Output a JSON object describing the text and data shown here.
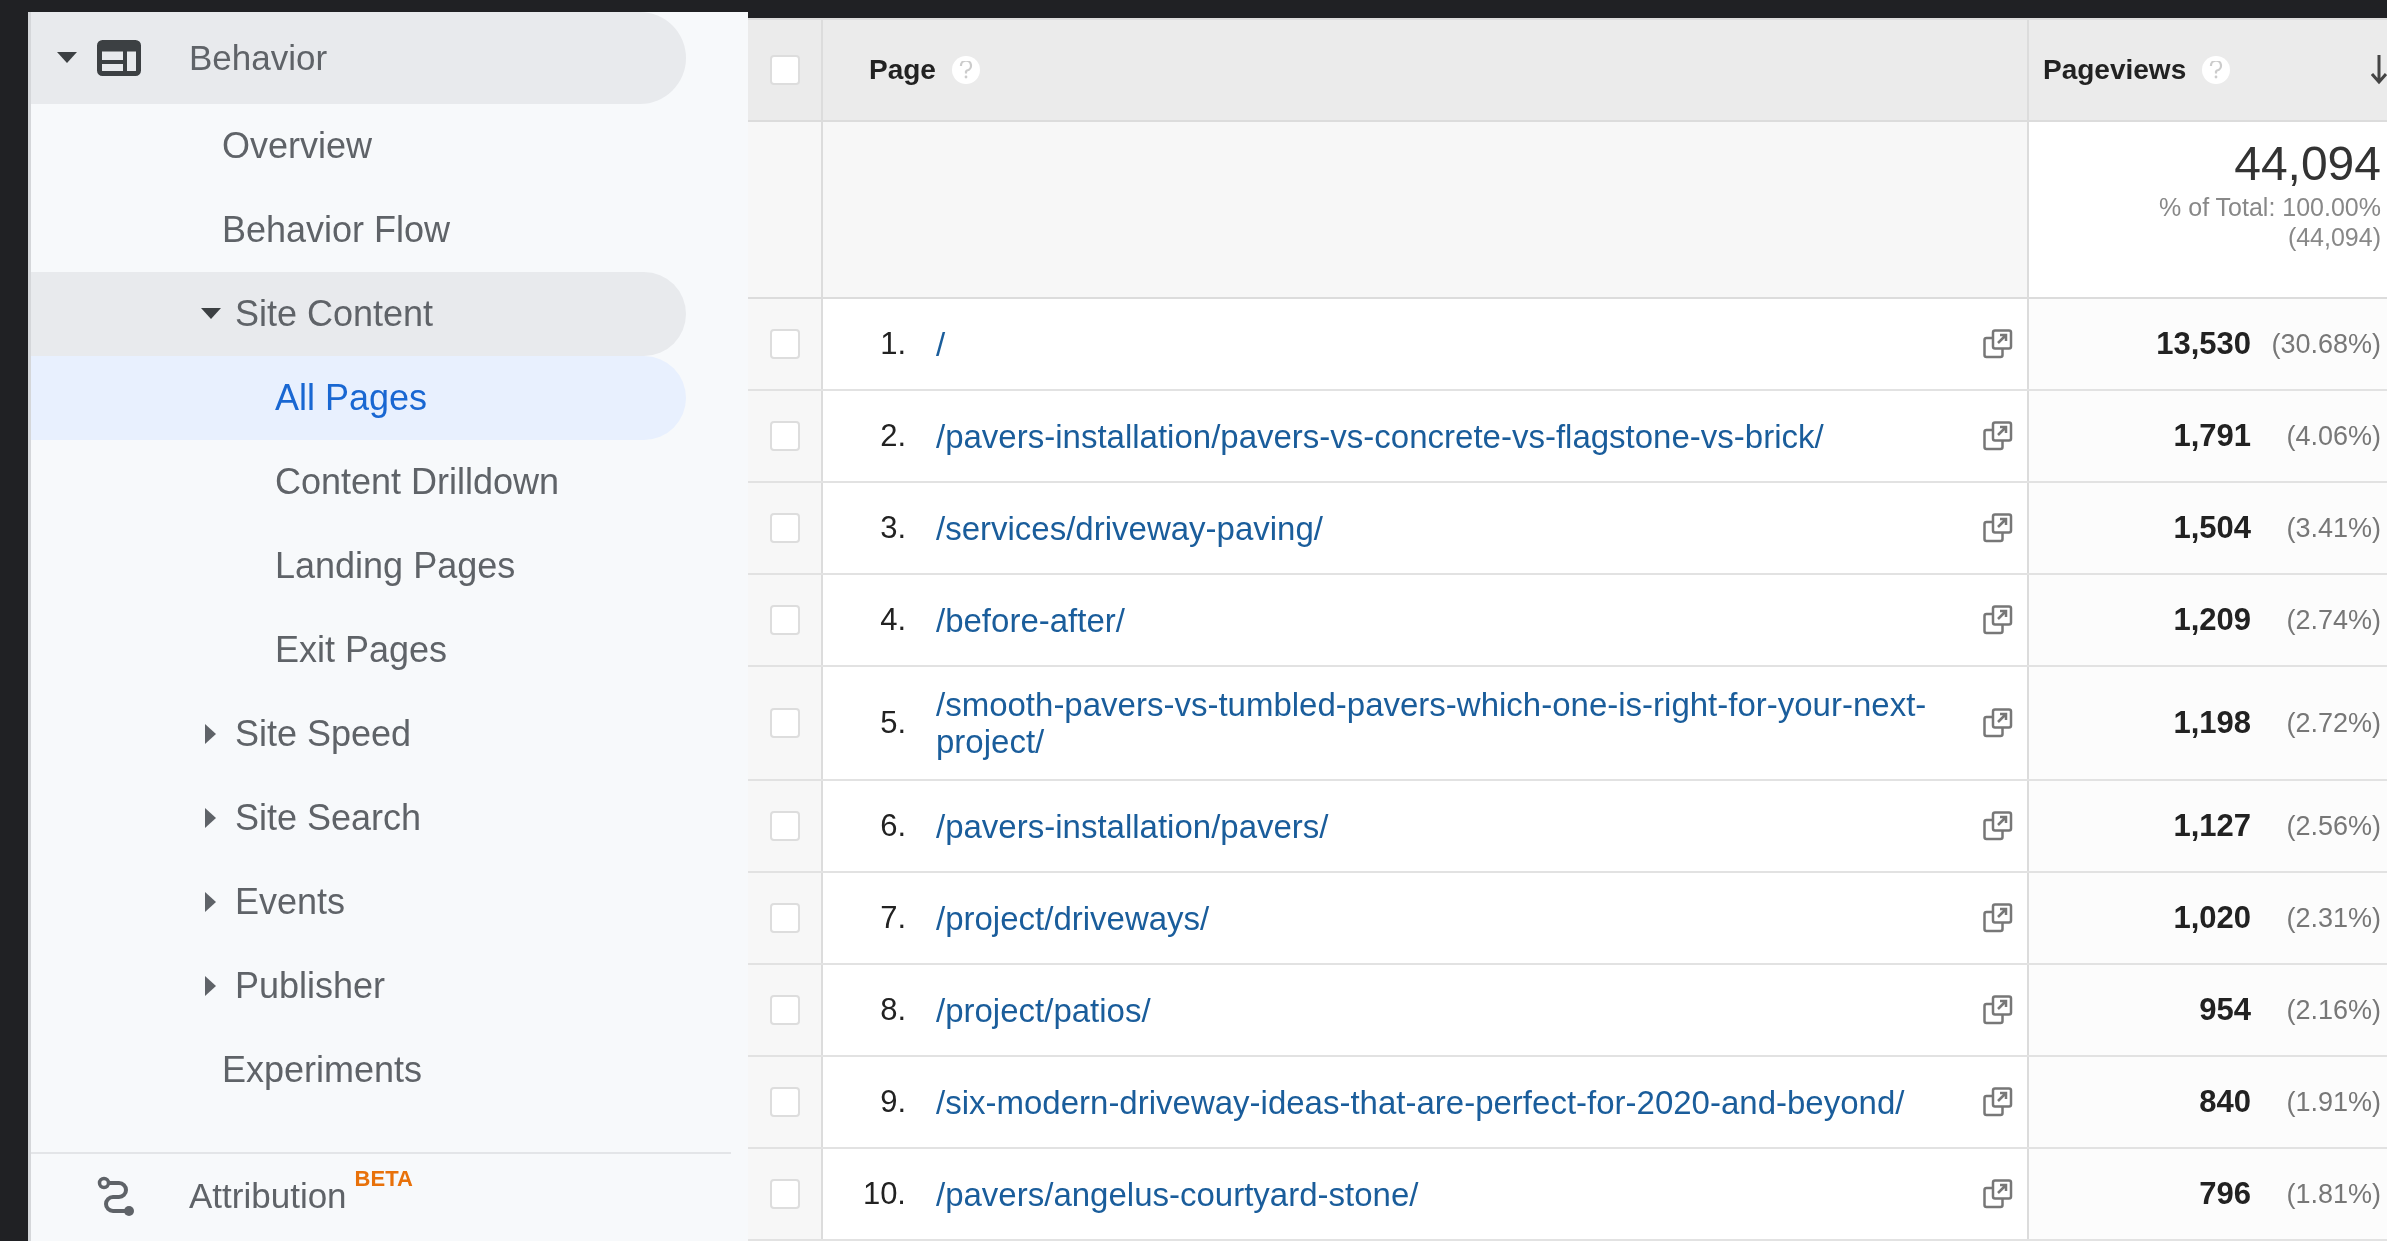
{
  "sidebar": {
    "section": {
      "label": "Behavior",
      "expanded": true,
      "selected": false,
      "items": [
        {
          "kind": "link",
          "label": "Overview",
          "selected": false
        },
        {
          "kind": "link",
          "label": "Behavior Flow",
          "selected": false
        },
        {
          "kind": "group",
          "label": "Site Content",
          "expanded": true,
          "selected": false,
          "children": [
            {
              "kind": "link",
              "label": "All Pages",
              "selected": true
            },
            {
              "kind": "link",
              "label": "Content Drilldown",
              "selected": false
            },
            {
              "kind": "link",
              "label": "Landing Pages",
              "selected": false
            },
            {
              "kind": "link",
              "label": "Exit Pages",
              "selected": false
            }
          ]
        },
        {
          "kind": "group",
          "label": "Site Speed",
          "expanded": false,
          "selected": false
        },
        {
          "kind": "group",
          "label": "Site Search",
          "expanded": false,
          "selected": false
        },
        {
          "kind": "group",
          "label": "Events",
          "expanded": false,
          "selected": false
        },
        {
          "kind": "group",
          "label": "Publisher",
          "expanded": false,
          "selected": false
        },
        {
          "kind": "link",
          "label": "Experiments",
          "selected": false
        }
      ]
    },
    "attribution": {
      "label": "Attribution",
      "badge": "BETA"
    }
  },
  "table": {
    "select_all": {
      "checked": false
    },
    "columns": [
      {
        "label": "Page"
      },
      {
        "label": "Pageviews",
        "sorted": true
      }
    ],
    "totals": {
      "value": "44,094",
      "percent": "% of Total: 100.00%",
      "total": "(44,094)"
    },
    "rows": [
      {
        "index": "1.",
        "page": "/",
        "pageviews": "13,530",
        "share": "(30.68%)",
        "checked": false
      },
      {
        "index": "2.",
        "page": "/pavers-installation/pavers-vs-concrete-vs-flagstone-vs-brick/",
        "pageviews": "1,791",
        "share": "(4.06%)",
        "checked": false
      },
      {
        "index": "3.",
        "page": "/services/driveway-paving/",
        "pageviews": "1,504",
        "share": "(3.41%)",
        "checked": false
      },
      {
        "index": "4.",
        "page": "/before-after/",
        "pageviews": "1,209",
        "share": "(2.74%)",
        "checked": false
      },
      {
        "index": "5.",
        "page": "/smooth-pavers-vs-tumbled-pavers-which-one-is-right-for-your-next-project/",
        "pageviews": "1,198",
        "share": "(2.72%)",
        "checked": false
      },
      {
        "index": "6.",
        "page": "/pavers-installation/pavers/",
        "pageviews": "1,127",
        "share": "(2.56%)",
        "checked": false
      },
      {
        "index": "7.",
        "page": "/project/driveways/",
        "pageviews": "1,020",
        "share": "(2.31%)",
        "checked": false
      },
      {
        "index": "8.",
        "page": "/project/patios/",
        "pageviews": "954",
        "share": "(2.16%)",
        "checked": false
      },
      {
        "index": "9.",
        "page": "/six-modern-driveway-ideas-that-are-perfect-for-2020-and-beyond/",
        "pageviews": "840",
        "share": "(1.91%)",
        "checked": false
      },
      {
        "index": "10.",
        "page": "/pavers/angelus-courtyard-stone/",
        "pageviews": "796",
        "share": "(1.81%)",
        "checked": false
      }
    ]
  }
}
